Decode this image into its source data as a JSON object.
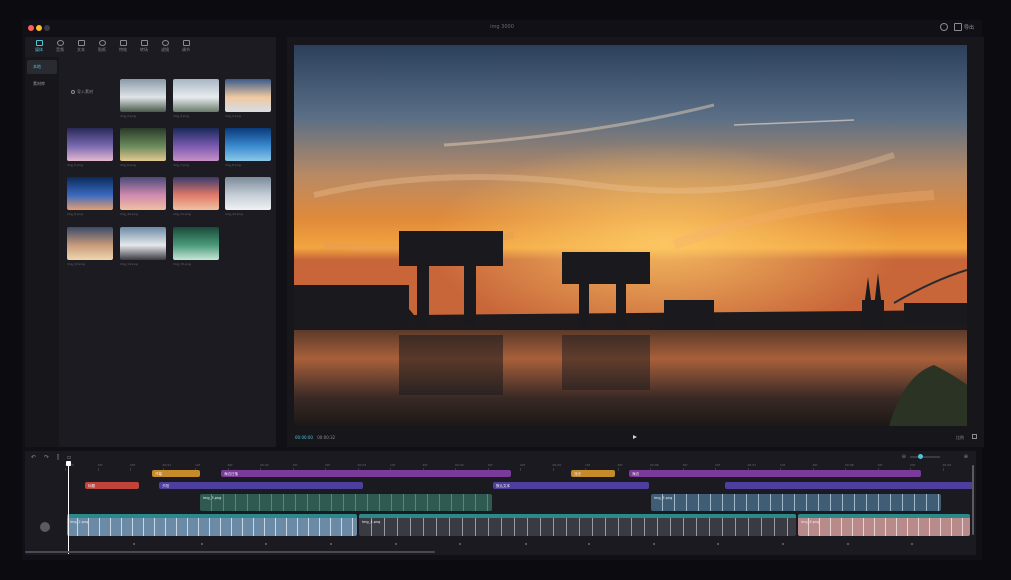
{
  "window": {
    "title": "img 3000"
  },
  "header": {
    "export_label": "导出"
  },
  "toolbar": {
    "items": [
      {
        "label": "媒体",
        "icon": "media-icon",
        "active": true
      },
      {
        "label": "音频",
        "icon": "audio-icon",
        "active": false
      },
      {
        "label": "文本",
        "icon": "text-icon",
        "active": false
      },
      {
        "label": "贴纸",
        "icon": "sticker-icon",
        "active": false
      },
      {
        "label": "特效",
        "icon": "effects-icon",
        "active": false
      },
      {
        "label": "转场",
        "icon": "transition-icon",
        "active": false
      },
      {
        "label": "滤镜",
        "icon": "filter-icon",
        "active": false
      },
      {
        "label": "调节",
        "icon": "adjust-icon",
        "active": false
      }
    ]
  },
  "sidenav": {
    "items": [
      {
        "label": "本地",
        "active": true
      },
      {
        "label": "素材库",
        "active": false
      }
    ]
  },
  "media": {
    "import_label": "导入素材",
    "thumbs": [
      {
        "label": "img_2.png"
      },
      {
        "label": "img_3.png"
      },
      {
        "label": "img_4.png"
      },
      {
        "label": "img_5.png"
      },
      {
        "label": "img_6.png"
      },
      {
        "label": "img_7.png"
      },
      {
        "label": "img_8.png"
      },
      {
        "label": "img_9.png"
      },
      {
        "label": "img_10.png"
      },
      {
        "label": "img_11.png"
      },
      {
        "label": "img_12.png"
      },
      {
        "label": "img_13.png"
      },
      {
        "label": "img_14.png"
      },
      {
        "label": "img_15.png"
      }
    ]
  },
  "preview": {
    "current_time": "00:00:00",
    "total_time": "00:00:32",
    "ratio_label": "比例"
  },
  "timeline": {
    "ruler": [
      "00:00",
      "10f",
      "20f",
      "00:01",
      "10f",
      "20f",
      "00:02",
      "10f",
      "20f",
      "00:03",
      "10f",
      "20f",
      "00:04",
      "10f",
      "20f",
      "00:05",
      "10f",
      "20f",
      "00:06",
      "10f",
      "20f",
      "00:07",
      "10f",
      "20f",
      "00:08",
      "10f",
      "20f",
      "00:09"
    ],
    "clips": {
      "c1": "开幕",
      "c2": "海边日落",
      "c3": "流光",
      "c4": "海边",
      "c5": "标题",
      "c6": "夕阳",
      "c7": "默认文本",
      "v1": "img_3.png",
      "v2": "img_5.png",
      "m1": "img_2.png",
      "m2": "img_4.png",
      "m3": "img_6.png"
    }
  }
}
